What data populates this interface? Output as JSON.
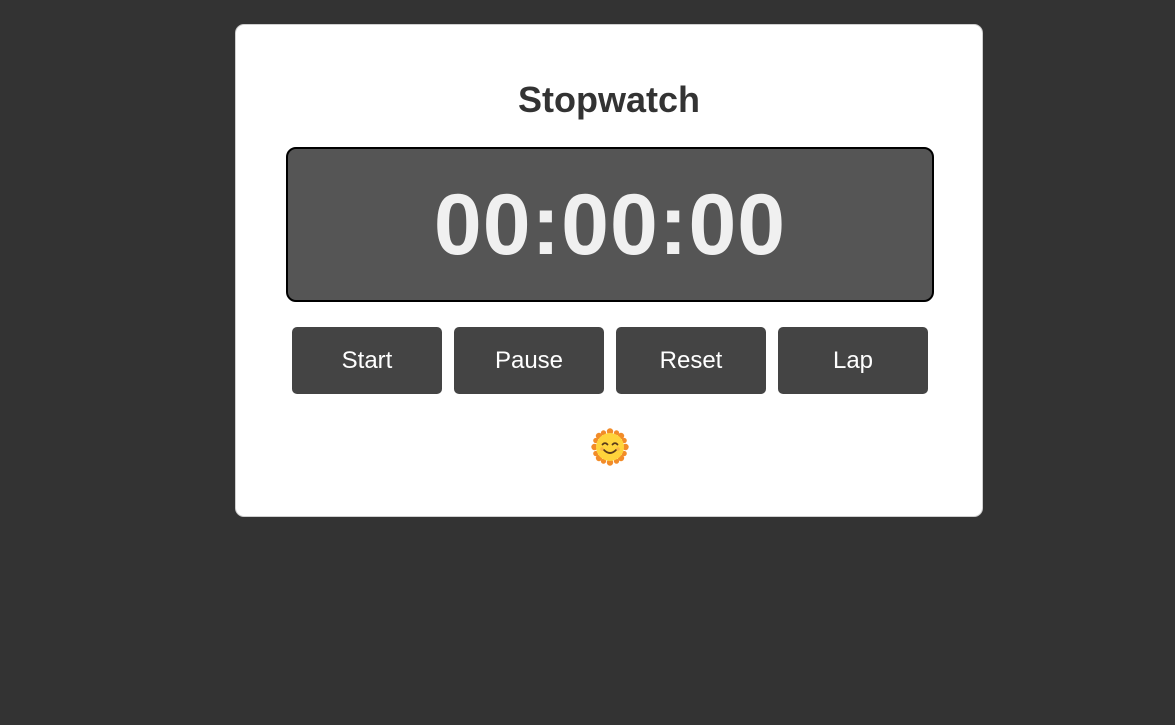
{
  "stopwatch": {
    "title": "Stopwatch",
    "time": "00:00:00",
    "buttons": {
      "start": "Start",
      "pause": "Pause",
      "reset": "Reset",
      "lap": "Lap"
    },
    "mood_icon": "smiling-sun-icon"
  },
  "colors": {
    "background": "#333333",
    "card": "#ffffff",
    "display": "#555555",
    "button": "#444444",
    "time_text": "#f0f0f0"
  }
}
